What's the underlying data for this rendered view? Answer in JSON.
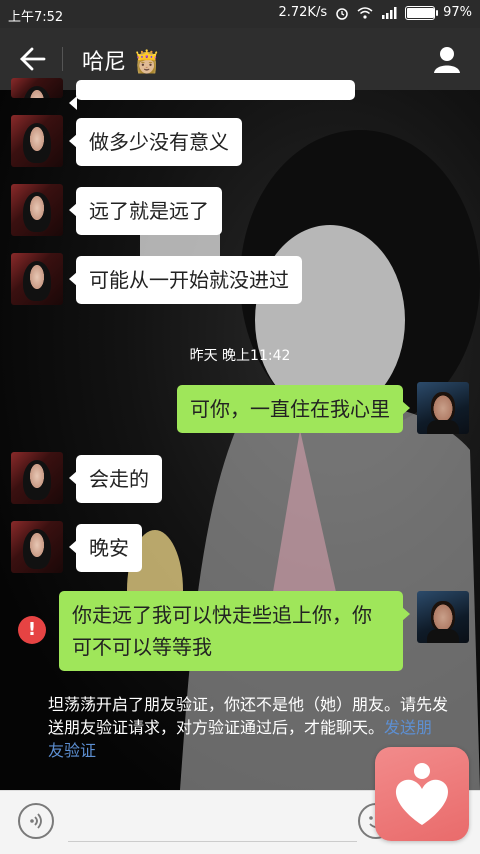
{
  "status_bar": {
    "time": "上午7:52",
    "network_speed": "2.72K/s",
    "battery_percent": "97%",
    "battery_level": 0.97
  },
  "app_bar": {
    "title": "哈尼 👸🏼",
    "back_icon": "arrow-left-icon",
    "profile_icon": "person-icon"
  },
  "messages": [
    {
      "from": "her",
      "text": ""
    },
    {
      "from": "her",
      "text": "做多少没有意义"
    },
    {
      "from": "her",
      "text": "远了就是远了"
    },
    {
      "from": "her",
      "text": "可能从一开始就没进过"
    },
    {
      "from": "me",
      "text": "可你，一直住在我心里"
    },
    {
      "from": "her",
      "text": "会走的"
    },
    {
      "from": "her",
      "text": "晚安"
    },
    {
      "from": "me",
      "text": "你走远了我可以快走些追上你，你可不可以等等我",
      "failed": true
    }
  ],
  "timestamp": "昨天 晚上11:42",
  "notice": {
    "text": "坦荡荡开启了朋友验证，你还不是他（她）朋友。请先发送朋友验证请求，对方验证通过后，才能聊天。",
    "link": "发送朋友验证"
  },
  "input_bar": {
    "voice_icon": "voice-icon",
    "emoji_icon": "emoji-icon",
    "input_value": ""
  },
  "floating_app_icon": "heart-app-icon",
  "colors": {
    "outgoing_bubble": "#9fe65a",
    "incoming_bubble": "#ffffff",
    "error": "#e64343",
    "link": "#5d8fd2"
  }
}
